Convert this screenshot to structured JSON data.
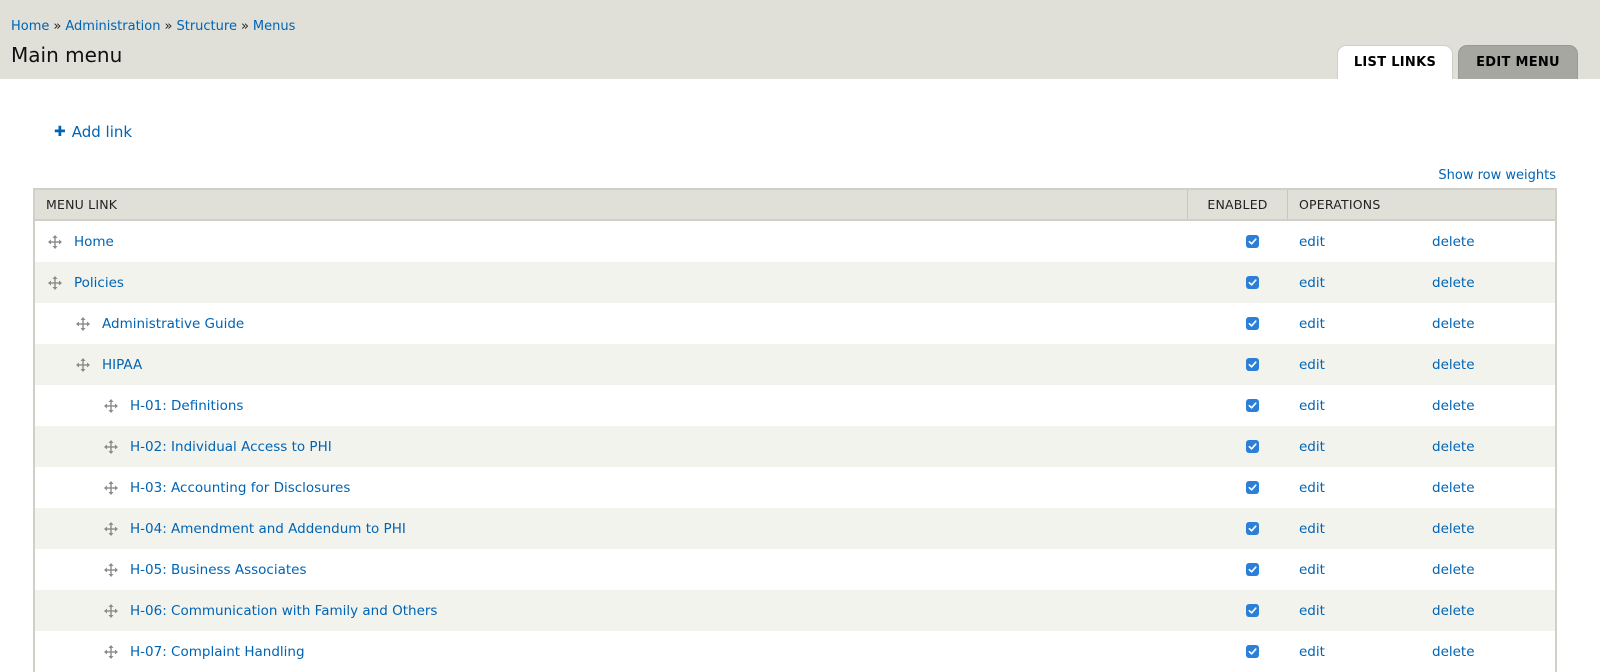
{
  "breadcrumb": {
    "items": [
      "Home",
      "Administration",
      "Structure",
      "Menus"
    ],
    "separator": "»"
  },
  "page_title": "Main menu",
  "tabs": [
    {
      "label": "LIST LINKS",
      "active": true
    },
    {
      "label": "EDIT MENU",
      "active": false
    }
  ],
  "actions": {
    "add_link": "Add link",
    "show_row_weights": "Show row weights"
  },
  "table": {
    "headers": {
      "menu_link": "MENU LINK",
      "enabled": "ENABLED",
      "operations": "OPERATIONS"
    },
    "operations": {
      "edit": "edit",
      "delete": "delete"
    },
    "rows": [
      {
        "label": "Home",
        "depth": 0,
        "enabled": true
      },
      {
        "label": "Policies",
        "depth": 0,
        "enabled": true
      },
      {
        "label": "Administrative Guide",
        "depth": 1,
        "enabled": true
      },
      {
        "label": "HIPAA",
        "depth": 1,
        "enabled": true
      },
      {
        "label": "H-01: Definitions",
        "depth": 2,
        "enabled": true
      },
      {
        "label": "H-02: Individual Access to PHI",
        "depth": 2,
        "enabled": true
      },
      {
        "label": "H-03: Accounting for Disclosures",
        "depth": 2,
        "enabled": true
      },
      {
        "label": "H-04: Amendment and Addendum to PHI",
        "depth": 2,
        "enabled": true
      },
      {
        "label": "H-05: Business Associates",
        "depth": 2,
        "enabled": true
      },
      {
        "label": "H-06: Communication with Family and Others",
        "depth": 2,
        "enabled": true
      },
      {
        "label": "H-07: Complaint Handling",
        "depth": 2,
        "enabled": true
      }
    ]
  },
  "colors": {
    "link": "#0064b4",
    "header_bg": "#e0e0d8",
    "checkbox": "#2b7fd8"
  }
}
